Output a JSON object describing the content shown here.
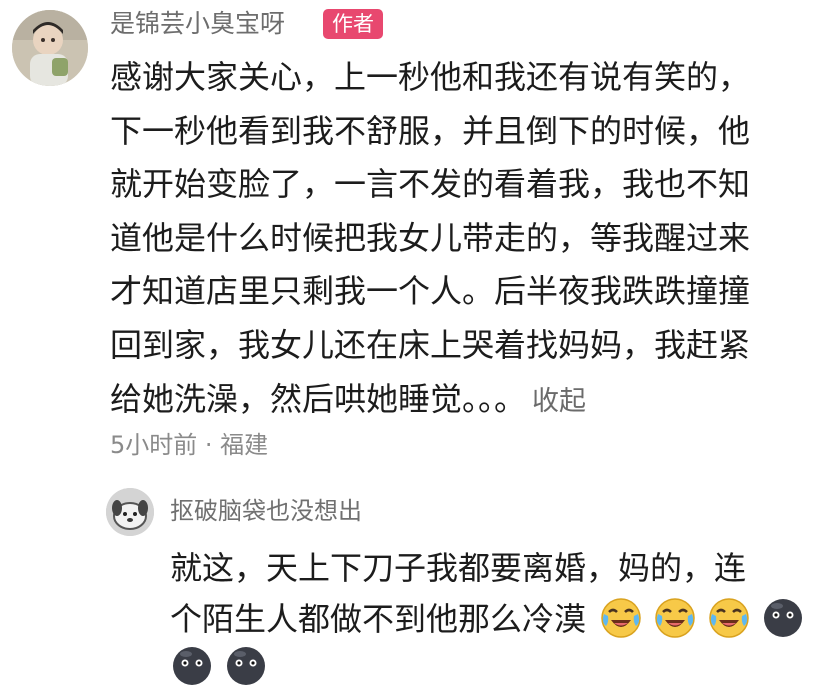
{
  "main_comment": {
    "username": "是锦芸小臭宝呀",
    "badge": "作者",
    "lines": [
      "感谢大家关心，上一秒他和我还有说有笑的，",
      "下一秒他看到我不舒服，并且倒下的时候，他",
      "就开始变脸了，一言不发的看着我，我也不知",
      "道他是什么时候把我女儿带走的，等我醒过来",
      "才知道店里只剩我一个人。后半夜我跌跌撞撞",
      "回到家，我女儿还在床上哭着找妈妈，我赶紧",
      "给她洗澡，然后哄她睡觉。。。"
    ],
    "collapse_label": "收起",
    "meta": "5小时前 · 福建"
  },
  "reply": {
    "username": "抠破脑袋也没想出",
    "lines": [
      "就这，天上下刀子我都要离婚，妈的，连",
      "个陌生人都做不到他那么冷漠"
    ],
    "emojis_line_2": [
      "crying-laughing-emoji",
      "crying-laughing-emoji",
      "crying-laughing-emoji",
      "dark-face-emoji"
    ],
    "emojis_line_3": [
      "dark-face-emoji",
      "dark-face-emoji"
    ]
  },
  "colors": {
    "badge": "#e8486f",
    "username": "#6d6d6d",
    "text": "#1c1c1c",
    "meta": "#8a8a8a",
    "emoji_yellow": "#f7c948",
    "emoji_tear": "#5fb8f0",
    "emoji_dark": "#3a3d46"
  }
}
